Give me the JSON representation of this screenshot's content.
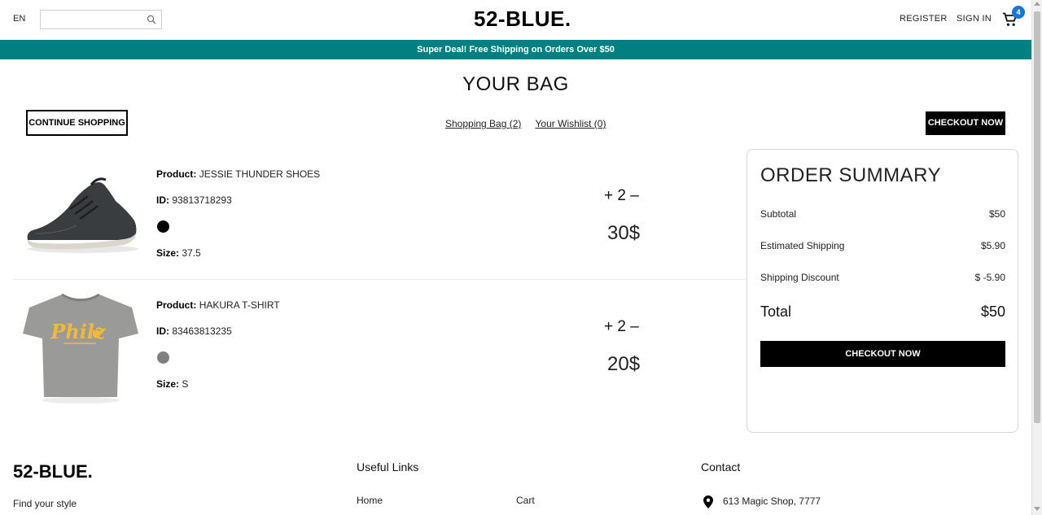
{
  "navbar": {
    "language": "EN",
    "search_placeholder": "",
    "logo": "52-BLUE.",
    "register": "REGISTER",
    "sign_in": "SIGN IN",
    "cart_count": "4",
    "badge_color": "#1976d2"
  },
  "announcement": {
    "text": "Super Deal! Free Shipping on Orders Over $50",
    "bg_color": "#008080"
  },
  "bag": {
    "title": "YOUR BAG",
    "continue_label": "CONTINUE SHOPPING",
    "shopping_bag_link": "Shopping Bag (2)",
    "wishlist_link": "Your Wishlist (0)",
    "checkout_label": "CHECKOUT NOW"
  },
  "products": [
    {
      "product_label": "Product:",
      "name": "JESSIE THUNDER SHOES",
      "id_label": "ID:",
      "id": "93813718293",
      "color": "#000000",
      "size_label": "Size:",
      "size": "37.5",
      "plus": "+",
      "quantity": "2",
      "minus": "–",
      "price": "30$",
      "image_icon": "sneaker-image"
    },
    {
      "product_label": "Product:",
      "name": "HAKURA T-SHIRT",
      "id_label": "ID:",
      "id": "83463813235",
      "color": "#808080",
      "size_label": "Size:",
      "size": "S",
      "plus": "+",
      "quantity": "2",
      "minus": "–",
      "price": "20$",
      "image_icon": "tshirt-image",
      "shirt_print": "Philz"
    }
  ],
  "summary": {
    "title": "ORDER SUMMARY",
    "subtotal_label": "Subtotal",
    "subtotal": "$50",
    "shipping_label": "Estimated Shipping",
    "shipping": "$5.90",
    "discount_label": "Shipping Discount",
    "discount": "$ -5.90",
    "total_label": "Total",
    "total": "$50",
    "checkout_label": "CHECKOUT NOW"
  },
  "footer": {
    "logo": "52-BLUE.",
    "tagline": "Find your style",
    "useful_links_title": "Useful Links",
    "links": [
      "Home",
      "Cart"
    ],
    "contact_title": "Contact",
    "address": "613 Magic Shop, 7777"
  }
}
